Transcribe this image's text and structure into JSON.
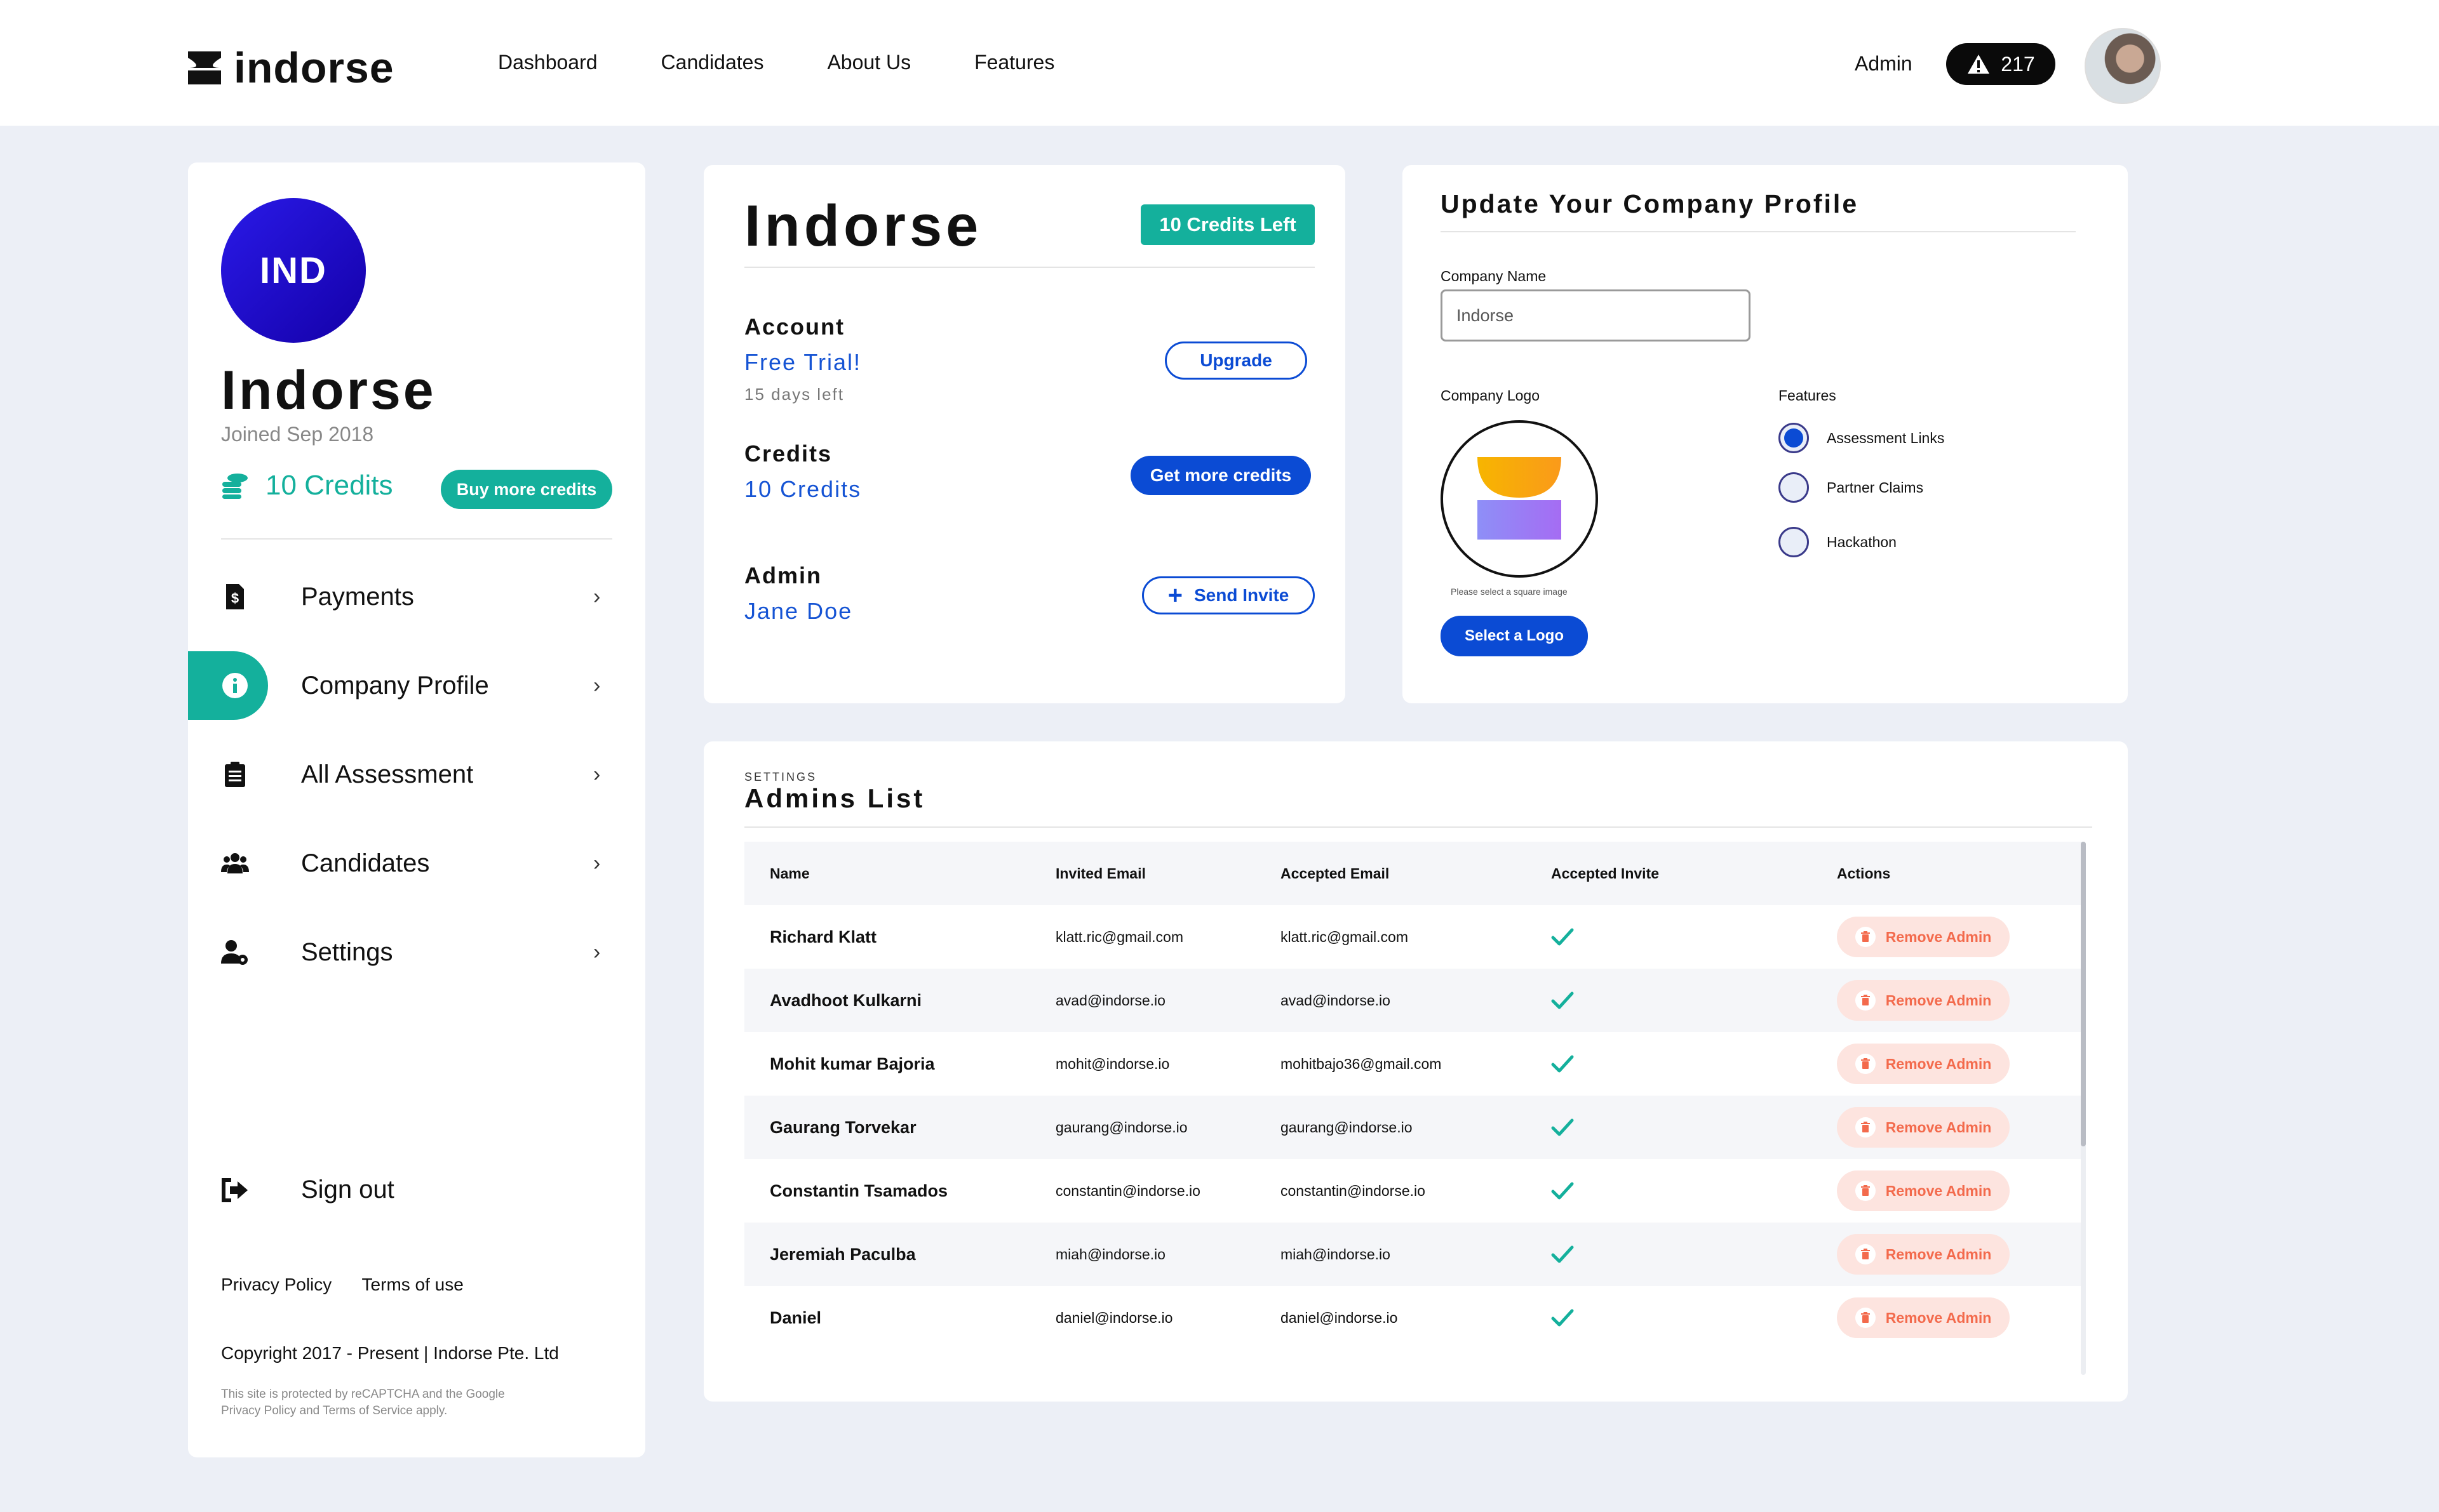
{
  "brand": {
    "name": "indorse"
  },
  "nav": {
    "items": [
      "Dashboard",
      "Candidates",
      "About Us",
      "Features"
    ]
  },
  "header": {
    "admin_label": "Admin",
    "notification_count": "217"
  },
  "sidebar": {
    "initials": "IND",
    "org_name": "Indorse",
    "joined": "Joined Sep 2018",
    "credits": "10 Credits",
    "buy_button": "Buy more credits",
    "menu": [
      {
        "label": "Payments",
        "icon": "payment-icon"
      },
      {
        "label": "Company Profile",
        "icon": "info-icon",
        "active": true
      },
      {
        "label": "All Assessment",
        "icon": "clipboard-icon"
      },
      {
        "label": "Candidates",
        "icon": "users-icon"
      },
      {
        "label": "Settings",
        "icon": "user-settings-icon"
      }
    ],
    "sign_out": "Sign out",
    "privacy": "Privacy Policy",
    "terms": "Terms of use",
    "copyright": "Copyright 2017 - Present | Indorse Pte. Ltd",
    "recaptcha_pre": "This site is protected by reCAPTCHA and the Google",
    "recaptcha_privacy": "Privacy Policy",
    "recaptcha_and": "and",
    "recaptcha_terms": "Terms of Service",
    "recaptcha_post": "apply."
  },
  "account": {
    "title": "Indorse",
    "credits_badge": "10 Credits Left",
    "account_label": "Account",
    "plan": "Free Trial!",
    "days_left": "15 days left",
    "upgrade": "Upgrade",
    "credits_label": "Credits",
    "credits_value": "10 Credits",
    "get_credits": "Get more credits",
    "admin_label": "Admin",
    "admin_name": "Jane Doe",
    "send_invite": "Send Invite"
  },
  "profile": {
    "title": "Update Your Company Profile",
    "company_name_label": "Company Name",
    "company_name_value": "Indorse",
    "company_logo_label": "Company Logo",
    "logo_hint": "Please select a square image",
    "select_logo": "Select a Logo",
    "features_label": "Features",
    "features": [
      {
        "label": "Assessment Links",
        "selected": true
      },
      {
        "label": "Partner Claims",
        "selected": false
      },
      {
        "label": "Hackathon",
        "selected": false
      }
    ]
  },
  "admins": {
    "caption": "SETTINGS",
    "title": "Admins List",
    "columns": [
      "Name",
      "Invited Email",
      "Accepted Email",
      "Accepted Invite",
      "Actions"
    ],
    "remove_label": "Remove Admin",
    "rows": [
      {
        "name": "Richard Klatt",
        "invited": "klatt.ric@gmail.com",
        "accepted": "klatt.ric@gmail.com",
        "accepted_invite": true
      },
      {
        "name": "Avadhoot Kulkarni",
        "invited": "avad@indorse.io",
        "accepted": "avad@indorse.io",
        "accepted_invite": true
      },
      {
        "name": "Mohit kumar Bajoria",
        "invited": "mohit@indorse.io",
        "accepted": "mohitbajo36@gmail.com",
        "accepted_invite": true
      },
      {
        "name": "Gaurang Torvekar",
        "invited": "gaurang@indorse.io",
        "accepted": "gaurang@indorse.io",
        "accepted_invite": true
      },
      {
        "name": "Constantin Tsamados",
        "invited": "constantin@indorse.io",
        "accepted": "constantin@indorse.io",
        "accepted_invite": true
      },
      {
        "name": "Jeremiah Paculba",
        "invited": "miah@indorse.io",
        "accepted": "miah@indorse.io",
        "accepted_invite": true
      },
      {
        "name": "Daniel",
        "invited": "daniel@indorse.io",
        "accepted": "daniel@indorse.io",
        "accepted_invite": true
      }
    ]
  },
  "colors": {
    "teal": "#14b09c",
    "blue": "#0b4bd4",
    "remove_bg": "#fde4df",
    "remove_text": "#f36a4c"
  }
}
